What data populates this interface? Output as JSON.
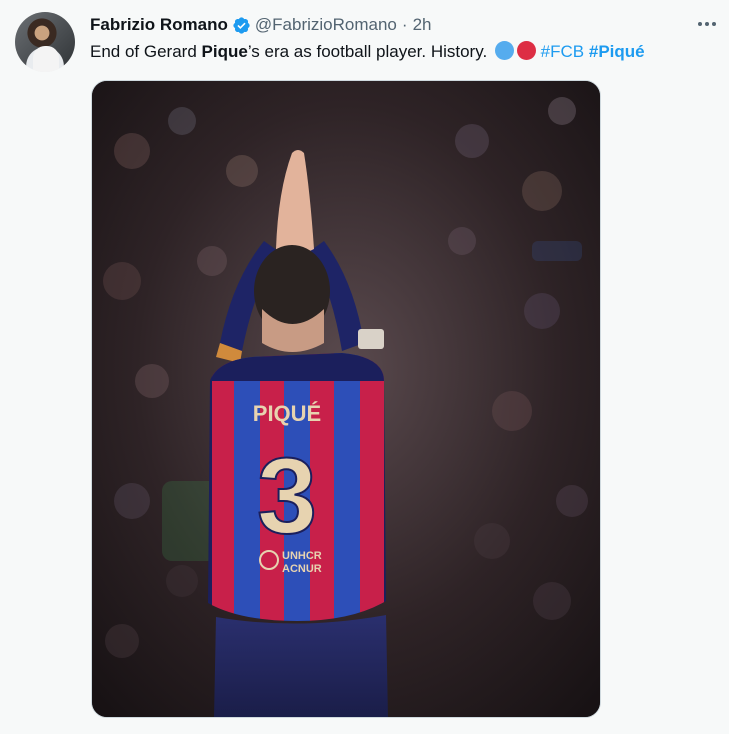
{
  "author": {
    "display_name": "Fabrizio Romano",
    "handle": "@FabrizioRomano",
    "separator": "·",
    "time": "2h",
    "verified_icon": "verified-badge-icon"
  },
  "tweet": {
    "text_start": "End of Gerard ",
    "text_bold": "Pique",
    "text_end": "’s era as football player. History.",
    "emoji": [
      {
        "name": "blue-circle-icon",
        "color": "#55acee"
      },
      {
        "name": "red-circle-icon",
        "color": "#dd2e44"
      }
    ],
    "hashtags": [
      {
        "label": "#FCB",
        "bold": false
      },
      {
        "label": "#Piqué",
        "bold": true
      }
    ]
  },
  "media": {
    "shirt_name": "PIQUÉ",
    "shirt_number": "3",
    "sponsor_line1": "UNHCR",
    "sponsor_line2": "ACNUR"
  },
  "colors": {
    "accent": "#1d9bf0",
    "text": "#0f1419",
    "muted": "#536471",
    "barca_blue": "#2d4fb8",
    "barca_red": "#c8204a",
    "barca_navy": "#1b1f5c"
  }
}
